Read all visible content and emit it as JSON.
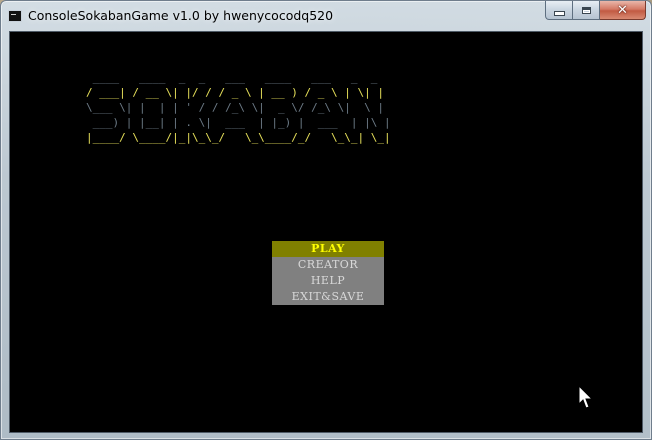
{
  "window": {
    "title": "ConsoleSokabanGame v1.0 by hwenycocodq520",
    "minimize_icon": "minimize-icon",
    "maximize_icon": "maximize-icon",
    "close_icon": "close-icon",
    "close_glyph": "✕"
  },
  "logo": {
    "text": "SOKABAN",
    "ascii_lines": [
      " ____   ____  _  _   ___   ____   ___   _  _ ",
      "/ ___| / __ \\| |/ / / _ \\ | __ ) / _ \\ | \\| |",
      "\\___ \\| |  | | ' / / /_\\ \\|  _ \\/ /_\\ \\|  \\ |",
      " ___) | |__| | . \\|  ___  | |_) |  ___  | |\\ |",
      "|____/ \\____/|_|\\_\\_/   \\_\\____/_/   \\_\\_| \\_|"
    ],
    "colors": {
      "highlight": "#e6e05a",
      "shadow": "#6c7a86"
    }
  },
  "menu": {
    "items": [
      {
        "label": "PLAY",
        "selected": true
      },
      {
        "label": "CREATOR",
        "selected": false
      },
      {
        "label": "HELP",
        "selected": false
      },
      {
        "label": "EXIT&SAVE",
        "selected": false
      }
    ],
    "colors": {
      "selected_bg": "#808000",
      "selected_fg": "#ffff00",
      "normal_bg": "#808080",
      "normal_fg": "#d8d8d8"
    }
  },
  "console": {
    "background": "#000000"
  },
  "pointer": {
    "icon": "mouse-pointer-icon"
  }
}
